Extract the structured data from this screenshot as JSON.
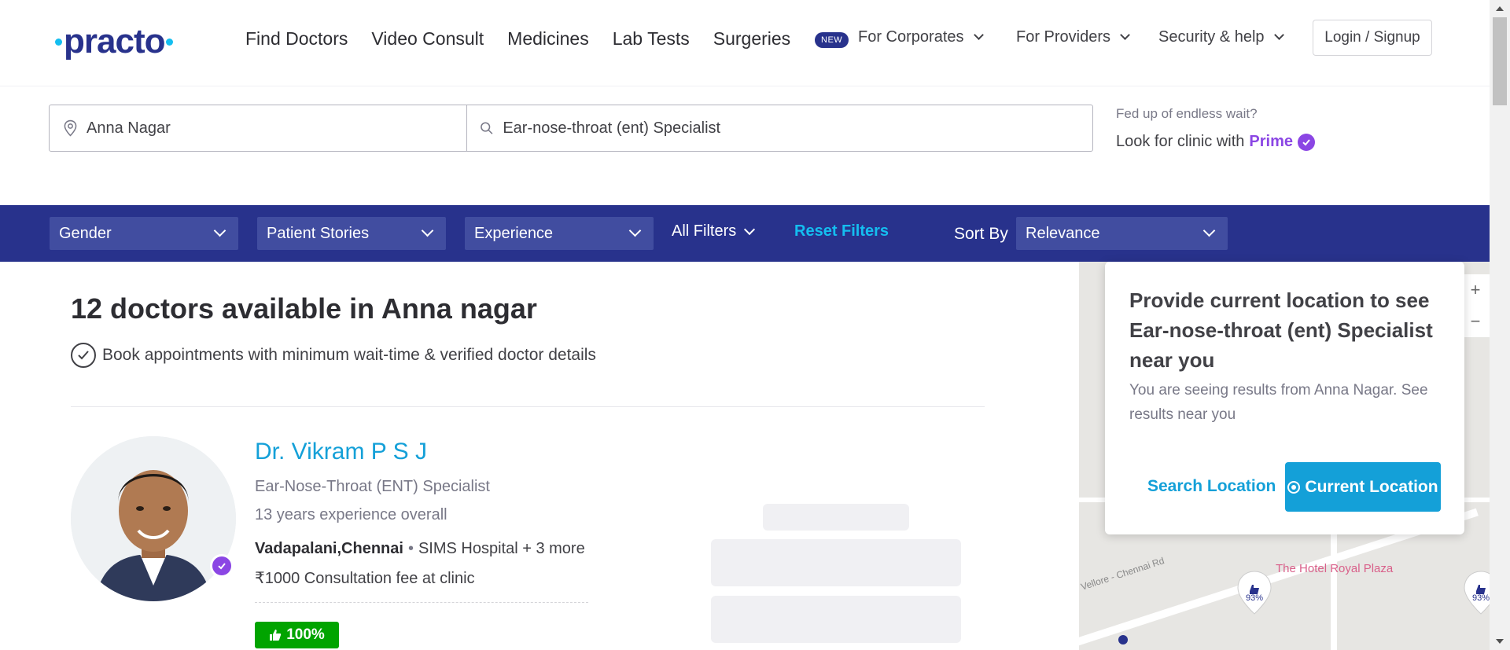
{
  "header": {
    "logo": "practo",
    "nav": [
      "Find Doctors",
      "Video Consult",
      "Medicines",
      "Lab Tests",
      "Surgeries"
    ],
    "new_badge": "NEW",
    "for_corporates": "For Corporates",
    "for_providers": "For Providers",
    "security_help": "Security & help",
    "login": "Login / Signup"
  },
  "search": {
    "location_value": "Anna Nagar",
    "query_value": "Ear-nose-throat (ent) Specialist"
  },
  "prime": {
    "line1": "Fed up of endless wait?",
    "line2": "Look for clinic with",
    "prime_word": "Prime"
  },
  "filters": {
    "gender": "Gender",
    "patient_stories": "Patient Stories",
    "experience": "Experience",
    "all_filters": "All Filters",
    "reset": "Reset Filters",
    "sort_by": "Sort By",
    "sort_value": "Relevance"
  },
  "results": {
    "title": "12 doctors available in Anna nagar",
    "subtitle": "Book appointments with minimum wait-time & verified doctor details"
  },
  "doctor": {
    "name": "Dr. Vikram P S J",
    "specialty": "Ear-Nose-Throat (ENT) Specialist",
    "experience": "13 years experience overall",
    "locality": "Vadapalani,Chennai",
    "clinic": "SIMS Hospital + 3 more",
    "fee": "₹1000 Consultation fee at clinic",
    "rating": "100%"
  },
  "map": {
    "road_label": "Vellore - Chennai Rd",
    "poi_label": "The Hotel Royal Plaza",
    "pin1": "93%",
    "pin2": "93%"
  },
  "popup": {
    "title": "Provide current location to see Ear-nose-throat (ent) Specialist near you",
    "subtitle": "You are seeing results from Anna Nagar. See results near you",
    "search_location": "Search Location",
    "current_location": "Current Location"
  },
  "colors": {
    "brand_navy": "#28328c",
    "brand_blue": "#14bef0",
    "link_blue": "#14a0d8",
    "prime_purple": "#8b46e4",
    "rating_green": "#01a400"
  }
}
